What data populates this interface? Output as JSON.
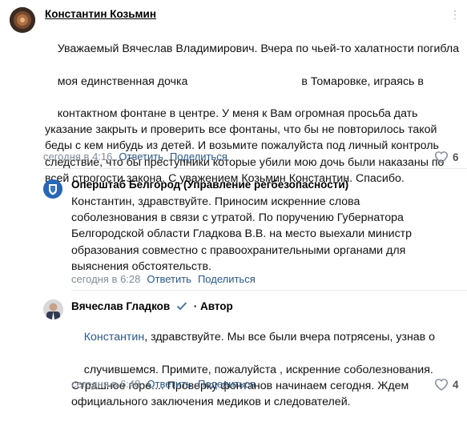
{
  "main_comment": {
    "author": "Константин Козьмин",
    "text_line1": "Уважаемый Вячеслав Владимирович. Вчера по чьей-то халатности погибла",
    "text_line2a": "моя единственная дочка",
    "text_line2b": "в Томаровке, играясь в",
    "text_rest": "контактном фонтане в центре. У меня к Вам огромная просьба дать\nуказание закрыть и проверить все фонтаны, что бы не повторилось такой\nбеды с кем нибудь из детей. И возьмите пожалуйста под личный контроль\nследствие, что бы преступники которые убили мою дочь были наказаны по\nвсей строгости закона. С уважением Козьмин Константин. Спасибо.",
    "time": "сегодня в 4:16",
    "reply_label": "Ответить",
    "share_label": "Поделиться",
    "likes": "6",
    "more_icon": "⋮"
  },
  "reply1": {
    "author": "Оперштаб Белгород (Управление регбезопасности)",
    "text": "Константин, здравствуйте. Приносим искренние слова\nсоболезнования в связи с утратой. По поручению Губернатора\nБелгородской области Гладкова В.В. на место выехали министр\nобразования совместно с правоохранительными органами для\nвыяснения обстоятельств.",
    "time": "сегодня в 6:28",
    "reply_label": "Ответить",
    "share_label": "Поделиться"
  },
  "reply2": {
    "author": "Вячеслав Гладков",
    "author_badge": "· Автор",
    "mention": "Константин",
    "text_first": ", здравствуйте. Мы все были вчера потрясены, узнав о",
    "text_rest": "случившемся. Примите, пожалуйста , искренние соболезнования.\nСтрашное горе.... Проверку фонтанов начинаем сегодня. Ждем\nофициального заключения медиков и следователей.",
    "time": "сегодня в 6:48",
    "reply_label": "Ответить",
    "share_label": "Поделиться",
    "likes": "4"
  },
  "colors": {
    "link": "#2a5885",
    "meta": "#818c99",
    "verified": "#4a76a8",
    "avatar_main_bg": "#3d2b22"
  },
  "icons": [
    "heart-icon",
    "more-icon",
    "verified-icon"
  ]
}
